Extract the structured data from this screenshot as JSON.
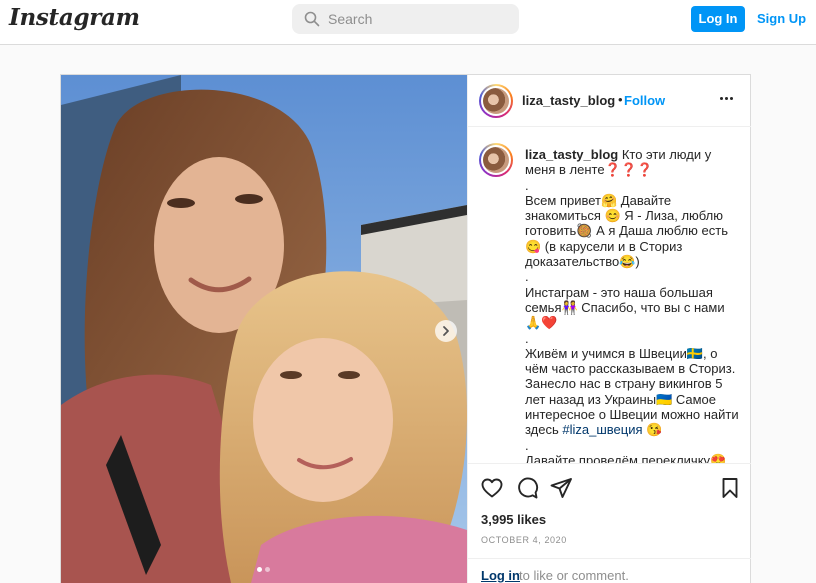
{
  "brand": {
    "logo_text": "Instagram"
  },
  "search": {
    "placeholder": "Search"
  },
  "auth": {
    "login_label": "Log In",
    "signup_label": "Sign Up"
  },
  "post": {
    "username": "liza_tasty_blog",
    "separator": "•",
    "follow_label": "Follow",
    "caption_text": "Кто эти люди у меня в ленте❓❓❓\n.\nВсем привет🤗 Давайте знакомиться 😊 Я - Лиза, люблю готовить🥘 А я Даша люблю есть😋 (в карусели и в Сториз доказательство😂)\n.\nИнстаграм - это наша большая семья👭 Спасибо, что вы с нами🙏❤️\n.\nЖивём и учимся в Швеции🇸🇪, о чём часто рассказываем в Сториз. Занесло нас в страну викингов 5 лет назад из Украины🇺🇦 Самое интересное о Швеции можно найти здесь ",
    "hashtag": "#liza_швеция",
    "caption_after_hashtag": " 😘\n.\nДавайте проведём перекличку😍",
    "likes": "3,995 likes",
    "date": "OCTOBER 4, 2020",
    "login_link": "Log in",
    "login_rest": "to like or comment.",
    "carousel": {
      "slides": 2,
      "current": 1
    }
  },
  "icons": {
    "search": "search-icon",
    "next": "chevron-right-icon",
    "more": "more-horizontal-icon",
    "like": "heart-icon",
    "comment": "comment-icon",
    "share": "share-icon",
    "save": "bookmark-icon"
  },
  "colors": {
    "accent": "#0095f6",
    "link_dark": "#00376b",
    "muted": "#8e8e8e",
    "border": "#dbdbdb"
  }
}
